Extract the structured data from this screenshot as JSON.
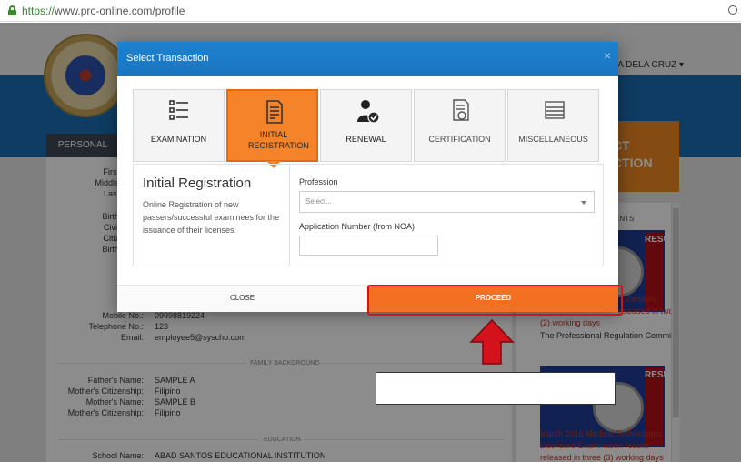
{
  "browser": {
    "url_protocol": "https://",
    "url_rest": "www.prc-online.com/profile"
  },
  "background": {
    "user_menu": "NA DELA CRUZ ▾",
    "personal_tab": "PERSONAL DATA",
    "select_transaction_partial": [
      "CT",
      "CTION"
    ],
    "sidebar_header": "ENTS",
    "side_labels": [
      "First",
      "Middle",
      "Last",
      "",
      "Birth",
      "Civil",
      "Citiz",
      "Birth"
    ],
    "contact_rows": [
      {
        "label": "Mobile No.:",
        "value": "09998819224"
      },
      {
        "label": "Telephone No.:",
        "value": "123"
      },
      {
        "label": "Email:",
        "value": "employee5@syscho.com"
      }
    ],
    "family_section": "FAMILY BACKGROUND",
    "family_rows": [
      {
        "label": "Father's Name:",
        "value": "SAMPLE A"
      },
      {
        "label": "Mother's Citizenship:",
        "value": "Filipino"
      },
      {
        "label": "Mother's Name:",
        "value": "SAMPLE B"
      },
      {
        "label": "Mother's Citizenship:",
        "value": "Filipino"
      }
    ],
    "education_section": "EDUCATION",
    "education_rows": [
      {
        "label": "School Name:",
        "value": "ABAD SANTOS EDUCATIONAL INSTITUTION"
      }
    ],
    "news": [
      {
        "partial_red": "Licensure",
        "partial_red2": "released in two",
        "red_line": "(2) working days",
        "dark": "The Professional Regulation Commi..."
      },
      {
        "red_lines": [
          "March 2016 Medical Technologist",
          "Licensure Examination results",
          "released in three (3) working days"
        ]
      }
    ],
    "result_label": "RESULT"
  },
  "modal": {
    "title": "Select Transaction",
    "close_symbol": "×",
    "tabs": [
      {
        "label": "EXAMINATION",
        "icon": "checklist-icon",
        "active": false
      },
      {
        "label": "INITIAL REGISTRATION",
        "icon": "document-icon",
        "active": true
      },
      {
        "label": "RENEWAL",
        "icon": "user-check-icon",
        "active": false
      },
      {
        "label": "CERTIFICATION",
        "icon": "certificate-icon",
        "active": false
      },
      {
        "label": "MISCELLANEOUS",
        "icon": "stack-icon",
        "active": false
      }
    ],
    "panel": {
      "title": "Initial Registration",
      "description": "Online Registration of new passers/successful examinees for the issuance of their licenses.",
      "profession_label": "Profession",
      "profession_value": "Select...",
      "app_number_label": "Application Number (from NOA)",
      "app_number_value": ""
    },
    "footer": {
      "close_label": "CLOSE",
      "proceed_label": "PROCEED"
    }
  },
  "colors": {
    "header_blue": "#1c78c6",
    "active_orange": "#f5832a",
    "proceed_orange": "#f36f21",
    "highlight_red": "#d4121b"
  }
}
